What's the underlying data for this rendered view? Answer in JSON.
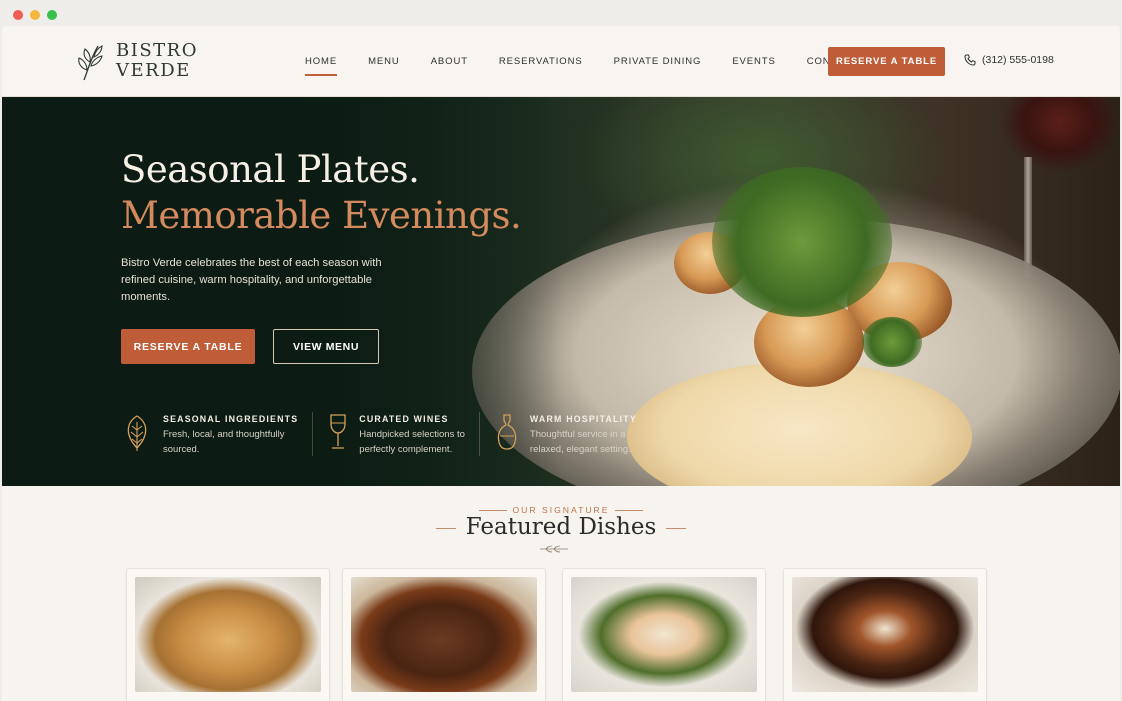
{
  "brand": {
    "line1": "BISTRO",
    "line2": "VERDE"
  },
  "nav": {
    "items": [
      "HOME",
      "MENU",
      "ABOUT",
      "RESERVATIONS",
      "PRIVATE DINING",
      "EVENTS",
      "CONTACT"
    ],
    "active": "HOME"
  },
  "header": {
    "cta_label": "RESERVE A TABLE",
    "phone": "(312) 555-0198"
  },
  "hero": {
    "headline_1": "Seasonal Plates.",
    "headline_2": "Memorable Evenings.",
    "description": "Bistro Verde celebrates the best of each season with refined cuisine, warm hospitality, and unforgettable moments.",
    "primary_button": "RESERVE A TABLE",
    "secondary_button": "VIEW MENU"
  },
  "features": [
    {
      "icon": "leaf-icon",
      "title": "SEASONAL INGREDIENTS",
      "desc_1": "Fresh, local, and thoughtfully",
      "desc_2": "sourced."
    },
    {
      "icon": "wine-glass-icon",
      "title": "CURATED WINES",
      "desc_1": "Handpicked selections to",
      "desc_2": "perfectly complement."
    },
    {
      "icon": "carafe-icon",
      "title": "WARM HOSPITALITY",
      "desc_1": "Thoughtful service in a",
      "desc_2": "relaxed, elegant setting."
    }
  ],
  "featured": {
    "eyebrow": "OUR SIGNATURE",
    "title": "Featured Dishes",
    "dishes": [
      "pasta",
      "steak",
      "fish",
      "dessert"
    ]
  },
  "colors": {
    "accent": "#bf5d39",
    "hero_dark": "#0d1f17",
    "headline_accent": "#d48a5d",
    "page_bg": "#f7f3ee"
  }
}
